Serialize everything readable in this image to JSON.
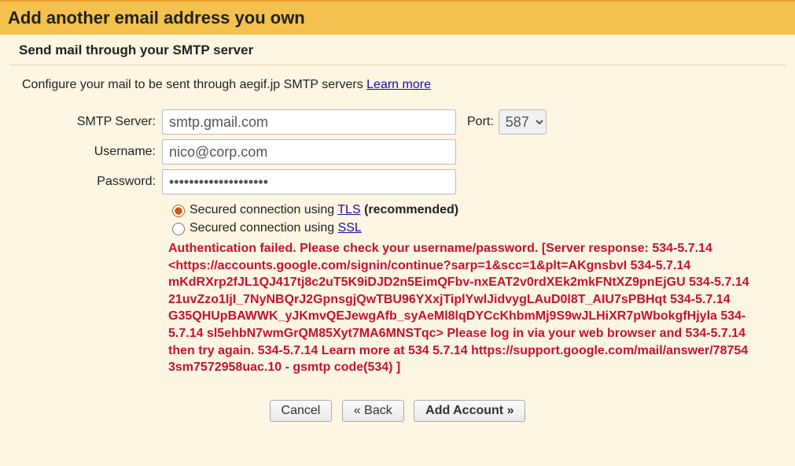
{
  "header": {
    "title": "Add another email address you own"
  },
  "subheader": "Send mail through your SMTP server",
  "intro": {
    "text": "Configure your mail to be sent through aegif.jp SMTP servers ",
    "linkText": "Learn more"
  },
  "form": {
    "smtpLabel": "SMTP Server:",
    "smtpValue": "smtp.gmail.com",
    "portLabel": "Port:",
    "portValue": "587",
    "usernameLabel": "Username:",
    "usernameValue": "nico@corp.com",
    "passwordLabel": "Password:",
    "passwordValue": "••••••••••••••••••••"
  },
  "radios": {
    "tls_pre": "Secured connection using ",
    "tls_link": "TLS",
    "tls_post": " (recommended)",
    "ssl_pre": "Secured connection using ",
    "ssl_link": "SSL"
  },
  "error": "Authentication failed. Please check your username/password.\n[Server response: 534-5.7.14 <https://accounts.google.com/signin/continue?sarp=1&scc=1&plt=AKgnsbvI 534-5.7.14 mKdRXrp2fJL1QJ417tj8c2uT5K9iDJD2n5EimQFbv-nxEAT2v0rdXEk2mkFNtXZ9pnEjGU 534-5.7.14 21uvZzo1IjI_7NyNBQrJ2GpnsgjQwTBU96YXxjTiplYwlJidvygLAuD0l8T_AIU7sPBHqt 534-5.7.14 G35QHUpBAWWK_yJKmvQEJewgAfb_syAeMl8lqDYCcKhbmMj9S9wJLHiXR7pWbokgfHjyla 534-5.7.14 sl5ehbN7wmGrQM85Xyt7MA6MNSTqc> Please log in via your web browser and 534-5.7.14 then try again. 534-5.7.14 Learn more at 534 5.7.14 https://support.google.com/mail/answer/78754 3sm7572958uac.10 - gsmtp code(534) ]",
  "buttons": {
    "cancel": "Cancel",
    "back": "« Back",
    "add": "Add Account »"
  }
}
